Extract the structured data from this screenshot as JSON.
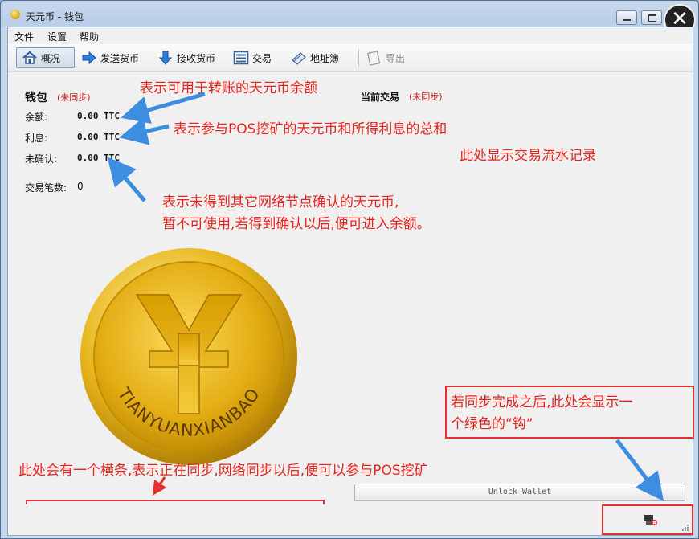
{
  "window": {
    "title": "天元币 - 钱包",
    "close_symbol": "✕"
  },
  "menu": [
    {
      "label": "文件"
    },
    {
      "label": "设置"
    },
    {
      "label": "帮助"
    }
  ],
  "toolbar": {
    "overview": "概况",
    "send": "发送货币",
    "receive": "接收货币",
    "transactions": "交易",
    "address_book": "地址簿",
    "export": "导出"
  },
  "wallet": {
    "heading": "钱包",
    "out_of_sync": "(未同步)",
    "balance_label": "余额:",
    "balance_value": "0.00 TTC",
    "stake_label": "利息:",
    "stake_value": "0.00 TTC",
    "unconfirmed_label": "未确认:",
    "unconfirmed_value": "0.00 TTC",
    "tx_count_label": "交易笔数:",
    "tx_count_value": "0"
  },
  "recent": {
    "heading": "当前交易",
    "out_of_sync": "(未同步)"
  },
  "coin": {
    "text": "TIANYUANXIANBAO"
  },
  "annotations": {
    "balance": "表示可用于转账的天元币余额",
    "stake": "表示参与POS挖矿的天元币和所得利息的总和",
    "txlog": "此处显示交易流水记录",
    "unconfirmed_1": "表示未得到其它网络节点确认的天元币,",
    "unconfirmed_2": "暂不可使用,若得到确认以后,便可进入余额。",
    "sync_check_1": "若同步完成之后,此处会显示一",
    "sync_check_2": "个绿色的“钩”",
    "progress": "此处会有一个横条,表示正在同步,网络同步以后,便可以参与POS挖矿"
  },
  "unlock_button": "Unlock Wallet",
  "colors": {
    "annotation_red": "#e8251f",
    "arrow_blue": "#3d8ee0",
    "coin_gold": "#e2b116"
  }
}
